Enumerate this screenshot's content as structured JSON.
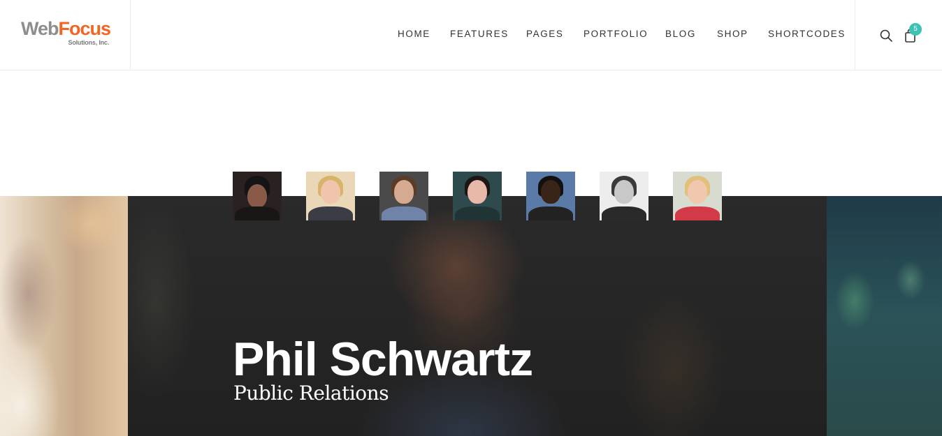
{
  "logo": {
    "word1": "Web",
    "word2": "Focus",
    "tagline": "Solutions, Inc."
  },
  "nav": {
    "items": [
      "HOME",
      "FEATURES",
      "PAGES",
      "PORTFOLIO",
      "BLOG",
      "SHOP",
      "SHORTCODES"
    ]
  },
  "cart": {
    "count": "5"
  },
  "colors": {
    "accent": "#f26522",
    "badge": "#3cc3b4",
    "logo_gray": "#8e8e8e"
  },
  "icons": {
    "search": "search-icon",
    "cart": "shopping-bag-icon"
  },
  "team": {
    "thumbnails": [
      {
        "name": "team-thumb-1"
      },
      {
        "name": "team-thumb-2"
      },
      {
        "name": "team-thumb-3"
      },
      {
        "name": "team-thumb-4"
      },
      {
        "name": "team-thumb-5"
      },
      {
        "name": "team-thumb-6"
      },
      {
        "name": "team-thumb-7"
      }
    ],
    "active": {
      "name": "Phil Schwartz",
      "role": "Public Relations"
    }
  }
}
